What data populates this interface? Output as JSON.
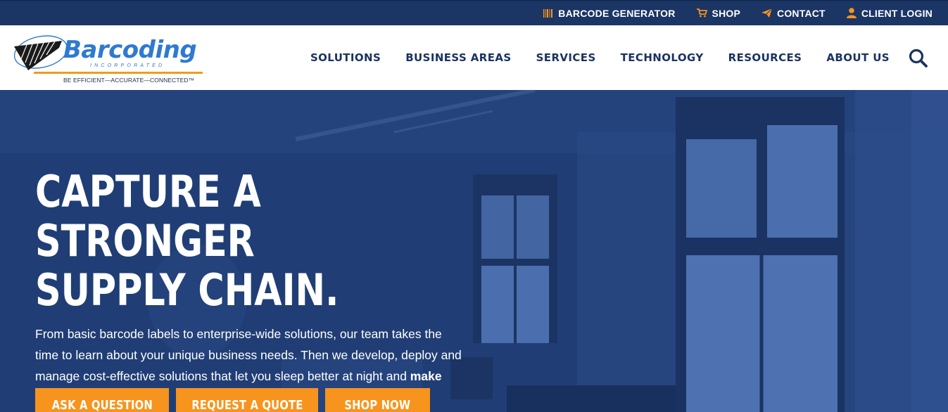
{
  "colors": {
    "topbar": "#1b3564",
    "nav_text": "#1b3360",
    "accent_orange": "#f6941e",
    "logo_blue": "#2f7ad0",
    "hero_overlay": "#1e3a6b"
  },
  "utility_nav": [
    {
      "label": "BARCODE GENERATOR",
      "icon": "barcode-icon"
    },
    {
      "label": "SHOP",
      "icon": "cart-icon"
    },
    {
      "label": "CONTACT",
      "icon": "paper-plane-icon"
    },
    {
      "label": "CLIENT LOGIN",
      "icon": "user-icon"
    }
  ],
  "logo": {
    "name": "Barcoding",
    "sub": "INCORPORATED",
    "tagline": "BE EFFICIENT—ACCURATE—CONNECTED™"
  },
  "main_nav": [
    "SOLUTIONS",
    "BUSINESS AREAS",
    "SERVICES",
    "TECHNOLOGY",
    "RESOURCES",
    "ABOUT US"
  ],
  "search": {
    "icon": "search-icon"
  },
  "hero": {
    "title_line1": "CAPTURE A STRONGER",
    "title_line2": "SUPPLY CHAIN.",
    "body": "From basic barcode labels to enterprise-wide solutions, our team takes the time to learn about your unique business needs. Then we develop, deploy and manage cost-effective solutions that let you sleep better at night and ",
    "body_strong": "make your customers smile.",
    "ctas": [
      "ASK A QUESTION",
      "REQUEST A QUOTE",
      "SHOP NOW"
    ]
  }
}
